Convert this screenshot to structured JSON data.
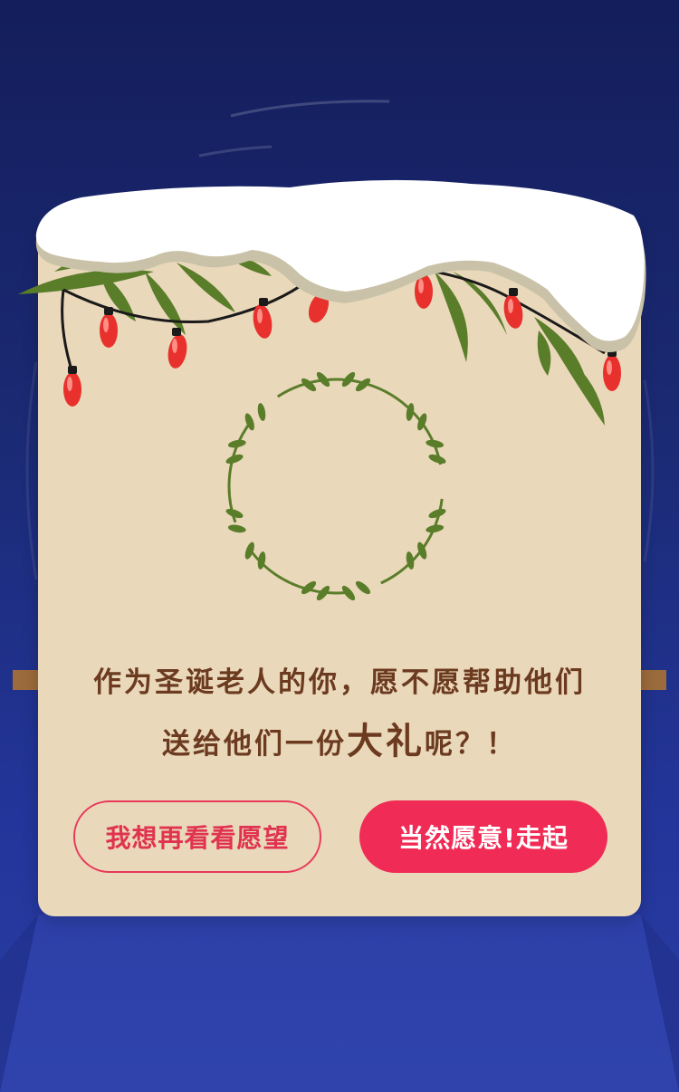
{
  "dialog": {
    "message_line1": "作为圣诞老人的你，愿不愿帮助他们",
    "message_line2_prefix": "送给他们一份",
    "message_line2_emphasis": "大礼",
    "message_line2_suffix": "呢？！"
  },
  "buttons": {
    "secondary_label": "我想再看看愿望",
    "primary_label": "当然愿意!走起"
  },
  "colors": {
    "background_top": "#141e5c",
    "background_bottom": "#2a3da4",
    "card": "#ead8bb",
    "text": "#6b3a1f",
    "accent": "#f02b55",
    "leaf": "#5a7d2a",
    "bulb": "#e8312d"
  },
  "icons": [
    "snow-cap-icon",
    "christmas-lights-icon",
    "pine-branch-icon",
    "laurel-wreath-icon"
  ]
}
